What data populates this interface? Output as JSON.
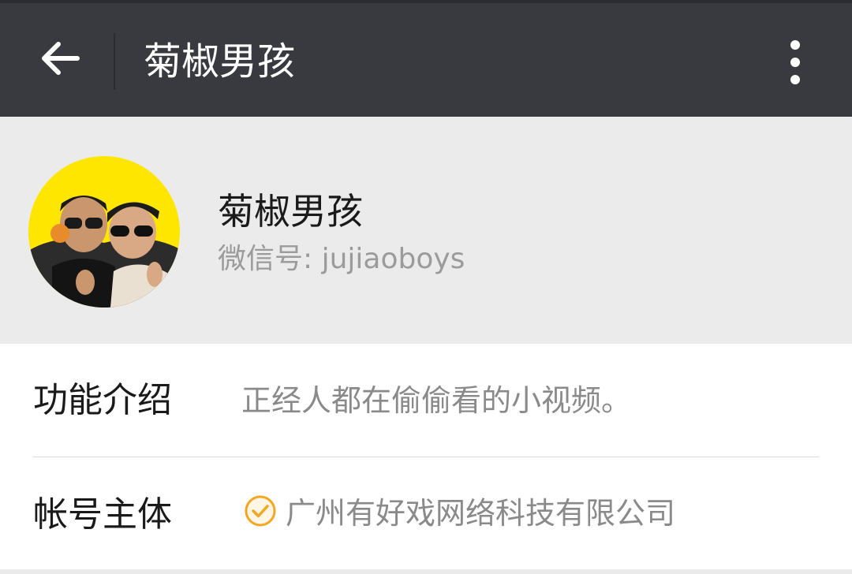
{
  "topbar": {
    "title": "菊椒男孩",
    "back_icon": "arrow-left-icon",
    "more_icon": "more-vertical-icon"
  },
  "profile": {
    "name": "菊椒男孩",
    "wechat_id": "微信号: jujiaoboys",
    "avatar_icon": "avatar-photo"
  },
  "info": {
    "intro_label": "功能介绍",
    "intro_value": "正经人都在偷偷看的小视频。",
    "entity_label": "帐号主体",
    "entity_value": "广州有好戏网络科技有限公司",
    "verified_icon": "verified-check-icon"
  },
  "colors": {
    "topbar_bg": "#393a3f",
    "page_bg": "#ebebeb",
    "verified_accent": "#f5a623",
    "avatar_bg": "#ffe600"
  }
}
